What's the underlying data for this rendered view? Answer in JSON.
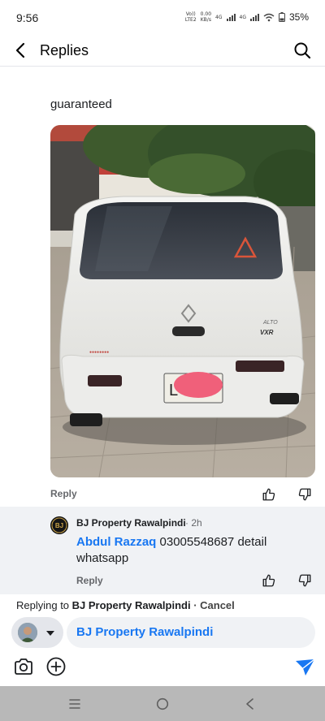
{
  "status_bar": {
    "time": "9:56",
    "net_1_top": "Vo))",
    "net_1_bottom": "LTE2",
    "net_speed_top": "0.00",
    "net_speed_bottom": "KB/s",
    "net_2": "4G",
    "net_3": "4G",
    "battery": "35%"
  },
  "header": {
    "title": "Replies",
    "back_icon": "arrow-left-icon",
    "search_icon": "search-icon"
  },
  "comment": {
    "text_tail": "guaranteed",
    "reply_label": "Reply"
  },
  "photo": {
    "plate_text": "L"
  },
  "reply": {
    "author": "BJ Property Rawalpindi",
    "time": "· 2h",
    "mention": "Abdul Razzaq",
    "body": " 03005548687 detail whatsapp",
    "reply_label": "Reply",
    "avatar_text": "BJ"
  },
  "composer": {
    "replying_prefix": "Replying to ",
    "replying_name": "BJ Property Rawalpindi",
    "cancel": " · Cancel",
    "input_value": "BJ Property Rawalpindi"
  },
  "colors": {
    "accent": "#1877f2",
    "secondary_text": "#65676b",
    "reply_bg": "#f0f2f5",
    "nav_bg": "#b8b8b8"
  }
}
